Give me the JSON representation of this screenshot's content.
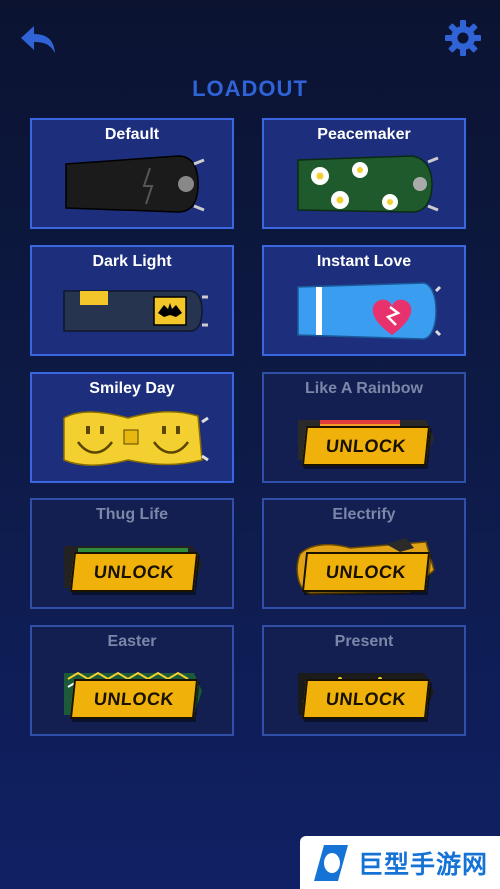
{
  "header": {
    "back_icon": "back-arrow-icon",
    "settings_icon": "gear-icon",
    "title": "LOADOUT"
  },
  "loadout": {
    "items": [
      {
        "name": "Default",
        "locked": false,
        "accent": "#1b1b1b"
      },
      {
        "name": "Peacemaker",
        "locked": false,
        "accent": "#1f5a2c"
      },
      {
        "name": "Dark Light",
        "locked": false,
        "accent": "#26344f"
      },
      {
        "name": "Instant Love",
        "locked": false,
        "accent": "#3b9df0"
      },
      {
        "name": "Smiley Day",
        "locked": false,
        "accent": "#f3d02f"
      },
      {
        "name": "Like A Rainbow",
        "locked": true,
        "accent": "#2a2a2a"
      },
      {
        "name": "Thug Life",
        "locked": true,
        "accent": "#222222"
      },
      {
        "name": "Electrify",
        "locked": true,
        "accent": "#e0a318"
      },
      {
        "name": "Easter",
        "locked": true,
        "accent": "#1c5a3a"
      },
      {
        "name": "Present",
        "locked": true,
        "accent": "#1b1b1b"
      }
    ],
    "unlock_label": "UNLOCK"
  },
  "watermark": {
    "text": "巨型手游网"
  },
  "colors": {
    "accent_blue": "#2f63d6",
    "card_border": "#3a66e0",
    "unlock_yellow": "#f0b20a"
  }
}
